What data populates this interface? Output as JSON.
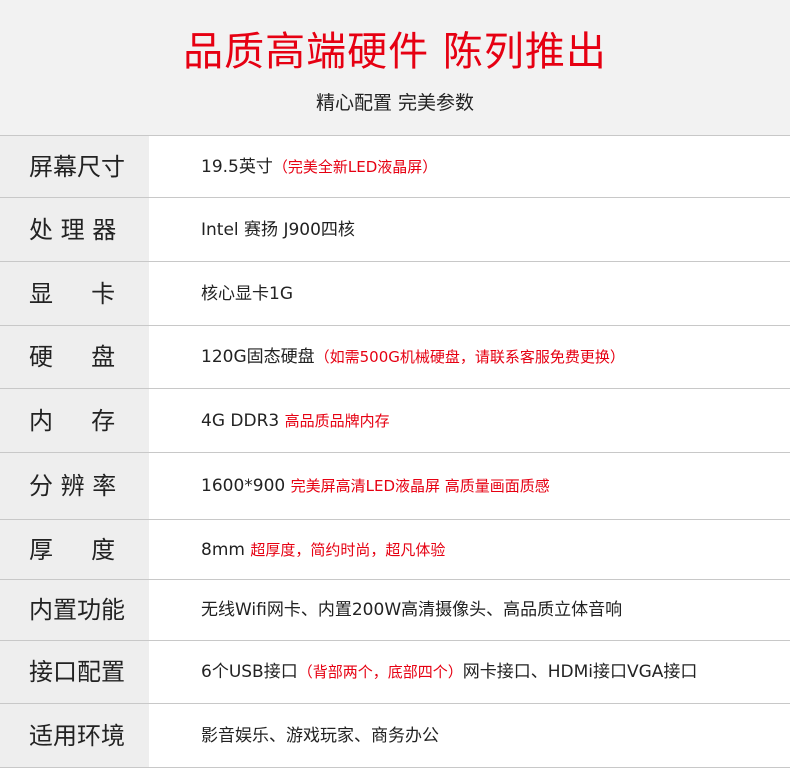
{
  "header": {
    "title": "品质高端硬件 陈列推出",
    "subtitle": "精心配置 完美参数"
  },
  "colors": {
    "accent": "#e60012",
    "label_bg": "#eeeeee",
    "header_bg": "#f2f2f2"
  },
  "specs": [
    {
      "label": "屏幕尺寸",
      "value": "19.5英寸",
      "note": "（完美全新LED液晶屏）",
      "extra": ""
    },
    {
      "label": "处 理 器",
      "value": "Intel 赛扬 J900四核",
      "note": "",
      "extra": ""
    },
    {
      "label": "显     卡",
      "value": "核心显卡1G",
      "note": "",
      "extra": ""
    },
    {
      "label": "硬     盘",
      "value": "120G固态硬盘",
      "note": "（如需500G机械硬盘，请联系客服免费更换）",
      "extra": ""
    },
    {
      "label": "内     存",
      "value": "4G DDR3 ",
      "note": "高品质品牌内存",
      "extra": ""
    },
    {
      "label": "分 辨 率",
      "value": "1600*900 ",
      "note": "完美屏高清LED液晶屏 高质量画面质感",
      "extra": ""
    },
    {
      "label": "厚     度",
      "value": "8mm  ",
      "note": "超厚度，简约时尚，超凡体验",
      "extra": ""
    },
    {
      "label": "内置功能",
      "value": "无线Wifi网卡、内置200W高清摄像头、高品质立体音响",
      "note": "",
      "extra": ""
    },
    {
      "label": "接口配置",
      "value": "6个USB接口",
      "note": "（背部两个，底部四个）",
      "extra": "网卡接口、HDMi接口VGA接口"
    },
    {
      "label": "适用环境",
      "value": "影音娱乐、游戏玩家、商务办公",
      "note": "",
      "extra": ""
    }
  ]
}
